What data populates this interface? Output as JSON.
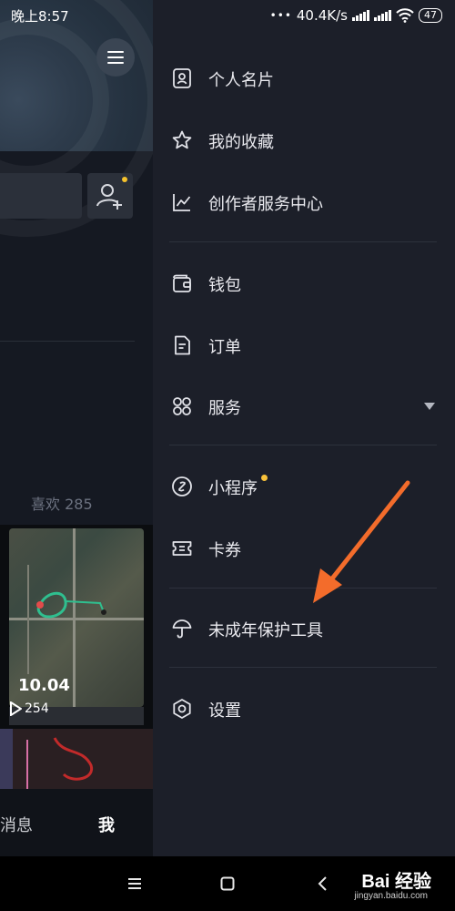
{
  "status_bar": {
    "time": "晚上8:57",
    "network_speed": "40.4K/s",
    "battery": "47"
  },
  "background_app": {
    "likes_label": "喜欢 285",
    "play_count": "254",
    "distance": "10.04",
    "tabs": {
      "messages": "消息",
      "me": "我"
    }
  },
  "drawer": {
    "items": [
      {
        "label": "个人名片",
        "icon": "profile-card-icon"
      },
      {
        "label": "我的收藏",
        "icon": "star-icon"
      },
      {
        "label": "创作者服务中心",
        "icon": "chart-icon"
      },
      {
        "label": "钱包",
        "icon": "wallet-icon"
      },
      {
        "label": "订单",
        "icon": "order-icon"
      },
      {
        "label": "服务",
        "icon": "grid-icon",
        "expandable": true
      },
      {
        "label": "小程序",
        "icon": "link-icon",
        "badge": true
      },
      {
        "label": "卡券",
        "icon": "coupon-icon"
      },
      {
        "label": "未成年保护工具",
        "icon": "umbrella-icon"
      },
      {
        "label": "设置",
        "icon": "gear-icon"
      }
    ]
  },
  "colors": {
    "drawer_bg": "#1c1f29",
    "badge": "#f8c13a",
    "annotation_arrow": "#f36c2b"
  },
  "watermark": {
    "brand": "Bai 经验",
    "site": "jingyan.baidu.com"
  }
}
